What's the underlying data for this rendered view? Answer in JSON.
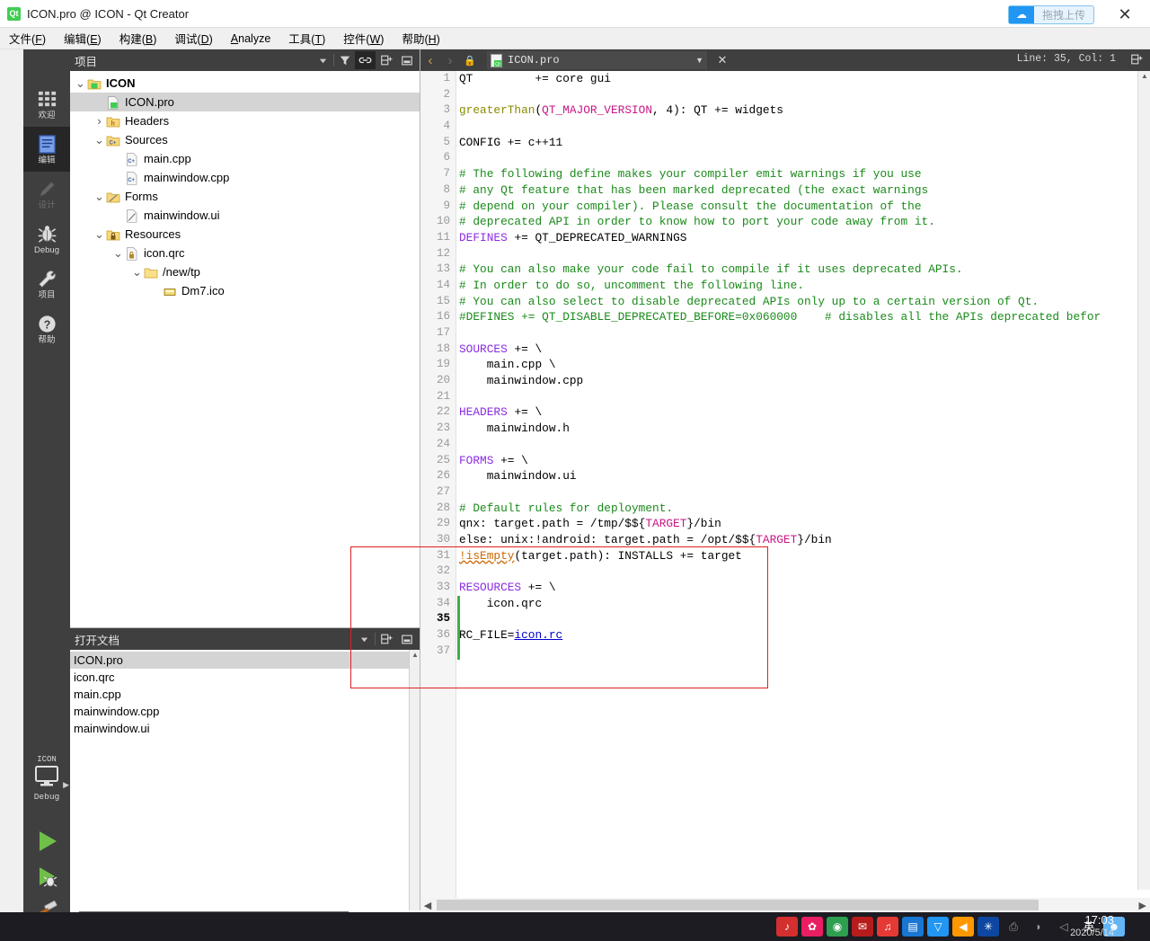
{
  "window": {
    "title": "ICON.pro @ ICON - Qt Creator",
    "app_icon_text": "Qt",
    "upload_button_label": "拖拽上传",
    "upload_icon": "cloud-upload-icon",
    "close_icon": "✕"
  },
  "menubar": [
    {
      "label": "文件",
      "mnemonic": "F"
    },
    {
      "label": "编辑",
      "mnemonic": "E"
    },
    {
      "label": "构建",
      "mnemonic": "B"
    },
    {
      "label": "调试",
      "mnemonic": "D"
    },
    {
      "label": "Analyze",
      "mnemonic": "A",
      "latin": true
    },
    {
      "label": "工具",
      "mnemonic": "T"
    },
    {
      "label": "控件",
      "mnemonic": "W"
    },
    {
      "label": "帮助",
      "mnemonic": "H"
    }
  ],
  "modebar": {
    "items": [
      {
        "label": "欢迎",
        "icon": "grid-icon",
        "state": "normal"
      },
      {
        "label": "编辑",
        "icon": "document-lines-icon",
        "state": "active"
      },
      {
        "label": "设计",
        "icon": "pencil-icon",
        "state": "disabled"
      },
      {
        "label": "Debug",
        "icon": "bug-icon",
        "state": "normal"
      },
      {
        "label": "项目",
        "icon": "wrench-icon",
        "state": "normal"
      },
      {
        "label": "帮助",
        "icon": "question-circle-icon",
        "state": "normal"
      }
    ],
    "kit": {
      "project_name": "ICON",
      "icon": "monitor-icon",
      "build_config": "Debug",
      "expander_icon": "chevron-right-icon"
    },
    "actions": [
      {
        "name": "run-button",
        "icon": "play-triangle-icon"
      },
      {
        "name": "debug-button",
        "icon": "play-bug-icon"
      },
      {
        "name": "build-button",
        "icon": "hammer-icon"
      }
    ]
  },
  "projects_dock": {
    "title": "项目",
    "toolbar": [
      {
        "name": "dropdown",
        "icon": "chevron-down-icon",
        "active": false
      },
      {
        "name": "filter",
        "icon": "filter-icon",
        "active": false
      },
      {
        "name": "sync-with-editor",
        "icon": "link-icon",
        "active": true
      },
      {
        "name": "split",
        "icon": "split-pane-icon",
        "active": false
      },
      {
        "name": "close-dock",
        "icon": "minimize-icon",
        "active": false
      }
    ],
    "tree": [
      {
        "label": "ICON",
        "depth": 0,
        "arrow": "down",
        "icon": "qt-project-icon",
        "bold": true,
        "selected": false
      },
      {
        "label": "ICON.pro",
        "depth": 1,
        "arrow": "none",
        "icon": "pro-file-icon",
        "bold": false,
        "selected": true
      },
      {
        "label": "Headers",
        "depth": 1,
        "arrow": "right",
        "icon": "h-folder-icon",
        "bold": false,
        "selected": false
      },
      {
        "label": "Sources",
        "depth": 1,
        "arrow": "down",
        "icon": "cpp-folder-icon",
        "bold": false,
        "selected": false
      },
      {
        "label": "main.cpp",
        "depth": 2,
        "arrow": "none",
        "icon": "cpp-file-icon",
        "bold": false,
        "selected": false
      },
      {
        "label": "mainwindow.cpp",
        "depth": 2,
        "arrow": "none",
        "icon": "cpp-file-icon",
        "bold": false,
        "selected": false
      },
      {
        "label": "Forms",
        "depth": 1,
        "arrow": "down",
        "icon": "ui-folder-icon",
        "bold": false,
        "selected": false
      },
      {
        "label": "mainwindow.ui",
        "depth": 2,
        "arrow": "none",
        "icon": "ui-file-icon",
        "bold": false,
        "selected": false
      },
      {
        "label": "Resources",
        "depth": 1,
        "arrow": "down",
        "icon": "qrc-folder-icon",
        "bold": false,
        "selected": false
      },
      {
        "label": "icon.qrc",
        "depth": 2,
        "arrow": "down",
        "icon": "qrc-file-icon",
        "bold": false,
        "selected": false
      },
      {
        "label": "/new/tp",
        "depth": 3,
        "arrow": "down",
        "icon": "folder-icon",
        "bold": false,
        "selected": false
      },
      {
        "label": "Dm7.ico",
        "depth": 4,
        "arrow": "none",
        "icon": "image-icon",
        "bold": false,
        "selected": false
      }
    ]
  },
  "docs_dock": {
    "title": "打开文档",
    "toolbar": [
      {
        "name": "dropdown",
        "icon": "chevron-down-icon"
      },
      {
        "name": "split",
        "icon": "split-pane-icon"
      },
      {
        "name": "close-dock",
        "icon": "minimize-icon"
      }
    ],
    "items": [
      {
        "label": "ICON.pro",
        "selected": true
      },
      {
        "label": "icon.qrc",
        "selected": false
      },
      {
        "label": "main.cpp",
        "selected": false
      },
      {
        "label": "mainwindow.cpp",
        "selected": false
      },
      {
        "label": "mainwindow.ui",
        "selected": false
      }
    ]
  },
  "editor": {
    "back_icon": "chevron-left-icon",
    "forward_icon": "chevron-right-icon",
    "lock_icon": "lock-icon",
    "file_icon": "pro-file-icon",
    "filename": "ICON.pro",
    "dropdown_icon": "chevron-down-icon",
    "close_icon": "✕",
    "position": "Line: 35, Col: 1",
    "split_icon": "split-pane-icon",
    "current_line": 35,
    "total_lines": 37,
    "lines": [
      {
        "n": 1,
        "tokens": [
          {
            "t": "QT         += core gui",
            "c": ""
          }
        ]
      },
      {
        "n": 2,
        "tokens": []
      },
      {
        "n": 3,
        "tokens": [
          {
            "t": "greaterThan",
            "c": "fn"
          },
          {
            "t": "(",
            "c": ""
          },
          {
            "t": "QT_MAJOR_VERSION",
            "c": "var"
          },
          {
            "t": ", 4): QT += widgets",
            "c": ""
          }
        ]
      },
      {
        "n": 4,
        "tokens": []
      },
      {
        "n": 5,
        "tokens": [
          {
            "t": "CONFIG += c++11",
            "c": ""
          }
        ]
      },
      {
        "n": 6,
        "tokens": []
      },
      {
        "n": 7,
        "tokens": [
          {
            "t": "# The following define makes your compiler emit warnings if you use",
            "c": "cmt"
          }
        ]
      },
      {
        "n": 8,
        "tokens": [
          {
            "t": "# any Qt feature that has been marked deprecated (the exact warnings",
            "c": "cmt"
          }
        ]
      },
      {
        "n": 9,
        "tokens": [
          {
            "t": "# depend on your compiler). Please consult the documentation of the",
            "c": "cmt"
          }
        ]
      },
      {
        "n": 10,
        "tokens": [
          {
            "t": "# deprecated API in order to know how to port your code away from it.",
            "c": "cmt"
          }
        ]
      },
      {
        "n": 11,
        "tokens": [
          {
            "t": "DEFINES",
            "c": "kw"
          },
          {
            "t": " += QT_DEPRECATED_WARNINGS",
            "c": ""
          }
        ]
      },
      {
        "n": 12,
        "tokens": []
      },
      {
        "n": 13,
        "tokens": [
          {
            "t": "# You can also make your code fail to compile if it uses deprecated APIs.",
            "c": "cmt"
          }
        ]
      },
      {
        "n": 14,
        "tokens": [
          {
            "t": "# In order to do so, uncomment the following line.",
            "c": "cmt"
          }
        ]
      },
      {
        "n": 15,
        "tokens": [
          {
            "t": "# You can also select to disable deprecated APIs only up to a certain version of Qt.",
            "c": "cmt"
          }
        ]
      },
      {
        "n": 16,
        "tokens": [
          {
            "t": "#DEFINES += QT_DISABLE_DEPRECATED_BEFORE=0x060000    # disables all the APIs deprecated befor",
            "c": "cmt"
          }
        ]
      },
      {
        "n": 17,
        "tokens": []
      },
      {
        "n": 18,
        "tokens": [
          {
            "t": "SOURCES",
            "c": "kw"
          },
          {
            "t": " += \\",
            "c": ""
          }
        ]
      },
      {
        "n": 19,
        "tokens": [
          {
            "t": "    main.cpp \\",
            "c": ""
          }
        ]
      },
      {
        "n": 20,
        "tokens": [
          {
            "t": "    mainwindow.cpp",
            "c": ""
          }
        ]
      },
      {
        "n": 21,
        "tokens": []
      },
      {
        "n": 22,
        "tokens": [
          {
            "t": "HEADERS",
            "c": "kw"
          },
          {
            "t": " += \\",
            "c": ""
          }
        ]
      },
      {
        "n": 23,
        "tokens": [
          {
            "t": "    mainwindow.h",
            "c": ""
          }
        ]
      },
      {
        "n": 24,
        "tokens": []
      },
      {
        "n": 25,
        "tokens": [
          {
            "t": "FORMS",
            "c": "kw"
          },
          {
            "t": " += \\",
            "c": ""
          }
        ]
      },
      {
        "n": 26,
        "tokens": [
          {
            "t": "    mainwindow.ui",
            "c": ""
          }
        ]
      },
      {
        "n": 27,
        "tokens": []
      },
      {
        "n": 28,
        "tokens": [
          {
            "t": "# Default rules for deployment.",
            "c": "cmt"
          }
        ]
      },
      {
        "n": 29,
        "tokens": [
          {
            "t": "qnx: target.path = /tmp/$${",
            "c": ""
          },
          {
            "t": "TARGET",
            "c": "var"
          },
          {
            "t": "}/bin",
            "c": ""
          }
        ]
      },
      {
        "n": 30,
        "tokens": [
          {
            "t": "else: unix:!android: target.path = /opt/$${",
            "c": ""
          },
          {
            "t": "TARGET",
            "c": "var"
          },
          {
            "t": "}/bin",
            "c": ""
          }
        ]
      },
      {
        "n": 31,
        "tokens": [
          {
            "t": "!isEmpty",
            "c": "err"
          },
          {
            "t": "(target.path): INSTALLS += target",
            "c": ""
          }
        ]
      },
      {
        "n": 32,
        "tokens": []
      },
      {
        "n": 33,
        "tokens": [
          {
            "t": "RESOURCES",
            "c": "kw"
          },
          {
            "t": " += \\",
            "c": ""
          }
        ]
      },
      {
        "n": 34,
        "tokens": [
          {
            "t": "    icon.qrc",
            "c": ""
          }
        ]
      },
      {
        "n": 35,
        "tokens": []
      },
      {
        "n": 36,
        "tokens": [
          {
            "t": "RC_FILE=",
            "c": ""
          },
          {
            "t": "icon.rc",
            "c": "lnk"
          }
        ]
      },
      {
        "n": 37,
        "tokens": []
      }
    ]
  },
  "annotation": {
    "name": "red-highlight-box",
    "color": "#e02020"
  },
  "taskbar": {
    "tray_icons": [
      {
        "name": "music-app-icon",
        "glyph": "♪",
        "color": "#d32f2f"
      },
      {
        "name": "photo-app-icon",
        "glyph": "✿",
        "color": "#e91e63"
      },
      {
        "name": "browser-icon",
        "glyph": "◉",
        "color": "#2e9e4f"
      },
      {
        "name": "chat-app-icon",
        "glyph": "✉",
        "color": "#b71c1c"
      },
      {
        "name": "qq-music-icon",
        "glyph": "♫",
        "color": "#e53935"
      },
      {
        "name": "editor-app-icon",
        "glyph": "▤",
        "color": "#1976d2"
      },
      {
        "name": "shield-icon",
        "glyph": "▽",
        "color": "#2196f3"
      },
      {
        "name": "volume-tray-icon",
        "glyph": "◀",
        "color": "#ff9800"
      },
      {
        "name": "bluetooth-icon",
        "glyph": "✳",
        "color": "#0d47a1"
      },
      {
        "name": "usb-eject-icon",
        "glyph": "⎙",
        "color": "#9e9e9e"
      },
      {
        "name": "wifi-icon",
        "glyph": "◗",
        "color": "#9e9e9e"
      },
      {
        "name": "speaker-icon",
        "glyph": "◁",
        "color": "#9e9e9e"
      },
      {
        "name": "ime-indicator",
        "glyph": "英",
        "color": "#ffffff"
      },
      {
        "name": "user-account-icon",
        "glyph": "☻",
        "color": "#64b5f6"
      }
    ],
    "clock_time": "17:03",
    "clock_date": "2020/5/14"
  }
}
